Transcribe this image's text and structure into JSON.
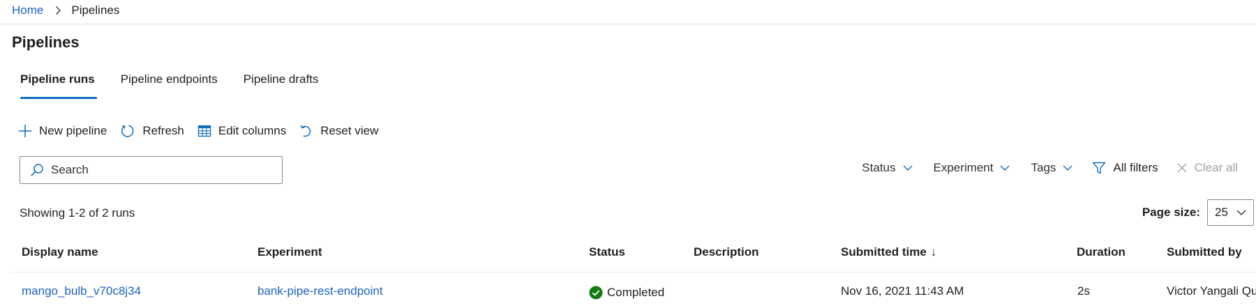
{
  "breadcrumb": {
    "home": "Home",
    "current": "Pipelines"
  },
  "page": {
    "title": "Pipelines"
  },
  "tabs": [
    {
      "label": "Pipeline runs",
      "active": true
    },
    {
      "label": "Pipeline endpoints",
      "active": false
    },
    {
      "label": "Pipeline drafts",
      "active": false
    }
  ],
  "toolbar": {
    "new_pipeline": "New pipeline",
    "refresh": "Refresh",
    "edit_columns": "Edit columns",
    "reset_view": "Reset view"
  },
  "search": {
    "placeholder": "Search",
    "value": ""
  },
  "filters": {
    "status": "Status",
    "experiment": "Experiment",
    "tags": "Tags",
    "all_filters": "All filters",
    "clear_all": "Clear all"
  },
  "summary": {
    "showing": "Showing 1-2 of 2 runs"
  },
  "page_size": {
    "label": "Page size:",
    "value": "25"
  },
  "table": {
    "columns": {
      "display_name": "Display name",
      "experiment": "Experiment",
      "status": "Status",
      "description": "Description",
      "submitted_time": "Submitted time",
      "submitted_time_sort": "↓",
      "duration": "Duration",
      "submitted_by": "Submitted by"
    },
    "rows": [
      {
        "display_name": "mango_bulb_v70c8j34",
        "experiment": "bank-pipe-rest-endpoint",
        "status": "Completed",
        "description": "",
        "submitted_time": "Nov 16, 2021 11:43 AM",
        "duration": "2s",
        "submitted_by": "Victor Yangali Qu"
      }
    ]
  },
  "colors": {
    "link": "#1a62c2",
    "accent": "#0f6cbd",
    "success": "#107c10",
    "text": "#201f1e",
    "disabled": "#a19f9d"
  }
}
